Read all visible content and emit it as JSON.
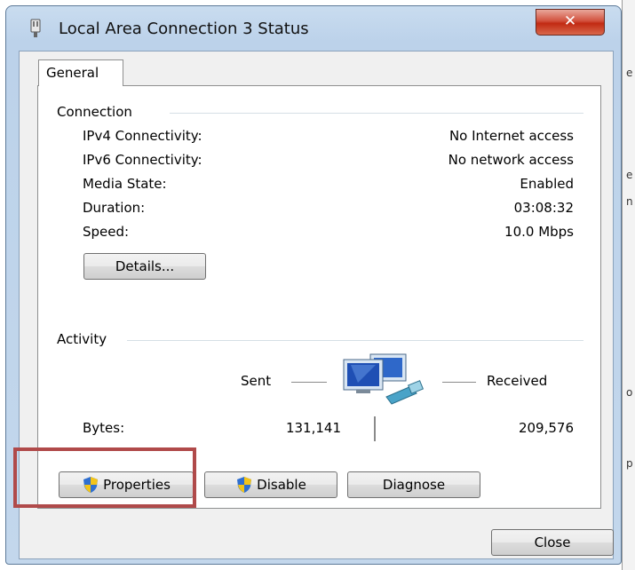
{
  "window": {
    "title": "Local Area Connection 3 Status",
    "close_symbol": "✕"
  },
  "tabs": [
    {
      "label": "General"
    }
  ],
  "connection": {
    "header": "Connection",
    "rows": [
      {
        "label": "IPv4 Connectivity:",
        "value": "No Internet access"
      },
      {
        "label": "IPv6 Connectivity:",
        "value": "No network access"
      },
      {
        "label": "Media State:",
        "value": "Enabled"
      },
      {
        "label": "Duration:",
        "value": "03:08:32"
      },
      {
        "label": "Speed:",
        "value": "10.0 Mbps"
      }
    ],
    "details_button": "Details..."
  },
  "activity": {
    "header": "Activity",
    "sent_label": "Sent",
    "received_label": "Received",
    "bytes_label": "Bytes:",
    "bytes_sent": "131,141",
    "bytes_received": "209,576",
    "icon": "network-computers-icon"
  },
  "buttons": {
    "properties": "Properties",
    "disable": "Disable",
    "diagnose": "Diagnose",
    "close": "Close"
  },
  "background_window": {
    "fragments": [
      "e",
      "e",
      "n",
      "o",
      "p"
    ]
  },
  "colors": {
    "highlight": "#b04a4a",
    "close_button": "#c12a12",
    "title_bar": "#bcd2ea"
  }
}
